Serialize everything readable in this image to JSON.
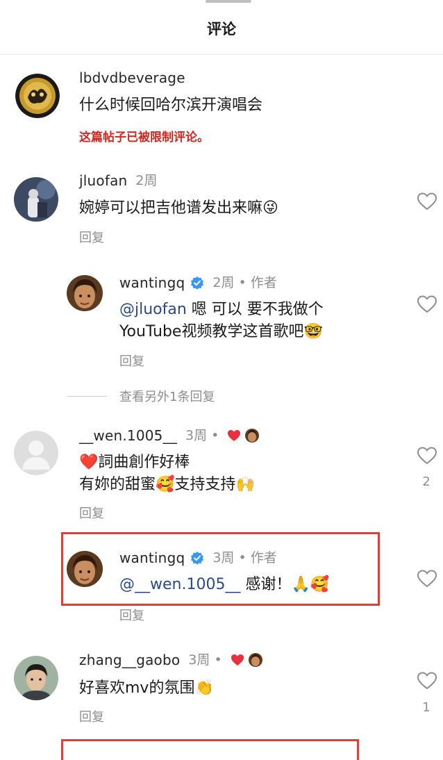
{
  "sheet": {
    "title": "评论"
  },
  "comments": [
    {
      "username": "lbdvdbeverage",
      "text": "什么时候回哈尔滨开演唱会",
      "restriction_notice": "这篇帖子已被限制评论。"
    },
    {
      "username": "jluofan",
      "time": "2周",
      "text": "婉婷可以把吉他谱发出来嘛",
      "text_emoji": "😜",
      "reply_label": "回复",
      "replies": [
        {
          "username": "wantingq",
          "time_author": "2周 • 作者",
          "mention": "@jluofan",
          "text_line1": " 嗯 可以 要不我做个",
          "text_line2": "YouTube视频教学这首歌吧",
          "text_emoji": "🤓",
          "reply_label": "回复"
        }
      ],
      "view_more_replies": "查看另外1条回复"
    },
    {
      "username": "__wen.1005__",
      "time": "3周 •",
      "text_line1": "詞曲創作好棒",
      "text_line1_emoji": "❤️",
      "text_line2_a": "有妳的甜蜜",
      "text_line2_emoji_a": "🥰",
      "text_line2_b": "支持支持",
      "text_line2_emoji_b": "🙌",
      "reply_label": "回复",
      "like_count": "2",
      "replies": [
        {
          "username": "wantingq",
          "time_author": "3周 • 作者",
          "mention": "@__wen.1005__",
          "text": " 感谢！",
          "text_emoji": "🙏🥰",
          "reply_label": "回复"
        }
      ]
    },
    {
      "username": "zhang__gaobo",
      "time": "3周 •",
      "text": "好喜欢mv的氛围",
      "text_emoji": "👏",
      "reply_label": "回复",
      "like_count": "1"
    }
  ],
  "colors": {
    "restriction": "#d0281e",
    "mention": "#2a4a87",
    "verified": "#3897f0",
    "highlight_box": "#d6423c",
    "liked_heart": "#e8303f"
  },
  "icons": {
    "like": "heart-outline-icon",
    "creator_liked": "heart-filled-icon",
    "verified": "verified-badge-icon"
  }
}
